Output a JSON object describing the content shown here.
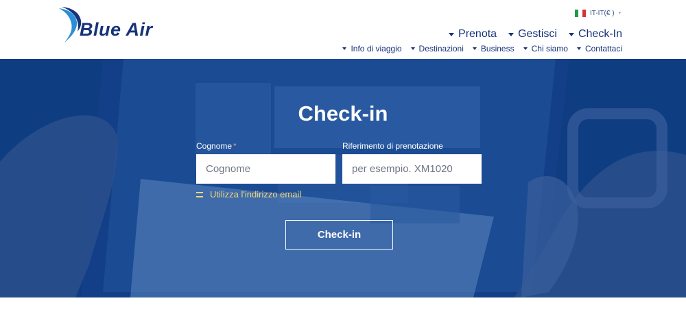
{
  "brand": {
    "name": "Blue Air",
    "color": "#16337a",
    "accent": "#2a8fd6"
  },
  "locale": {
    "flag": "italy-flag-icon",
    "label": "IT-IT(€ )"
  },
  "nav_main": [
    {
      "label": "Prenota"
    },
    {
      "label": "Gestisci"
    },
    {
      "label": "Check-In"
    }
  ],
  "nav_sub": [
    {
      "label": "Info di viaggio"
    },
    {
      "label": "Destinazioni"
    },
    {
      "label": "Business"
    },
    {
      "label": "Chi siamo"
    },
    {
      "label": "Contattaci"
    }
  ],
  "hero": {
    "title": "Check-in",
    "background_color": "#0f3d82"
  },
  "form": {
    "surname_label": "Cognome",
    "surname_required_mark": "*",
    "surname_placeholder": "Cognome",
    "booking_ref_label": "Riferimento di prenotazione",
    "booking_ref_placeholder": "per esempio. XM1020",
    "email_link": "Utilizza l'indirizzo email",
    "submit_label": "Check-in"
  }
}
